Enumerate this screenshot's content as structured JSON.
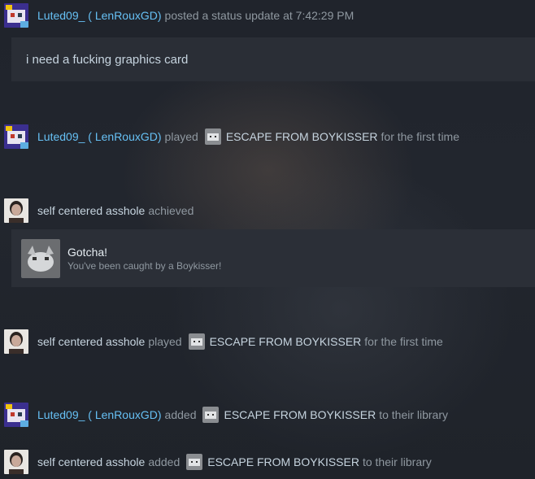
{
  "colors": {
    "link": "#66c0f4",
    "text": "#c6d4df",
    "muted": "#8f98a0",
    "panel": "#2a2e36"
  },
  "icons": {
    "user_avatar_luted": "pixel-avatar-icon",
    "user_avatar_self": "portrait-avatar-icon",
    "game": "game-icon",
    "achievement": "achievement-icon"
  },
  "feed": [
    {
      "user": "Luted09_ ( LenRouxGD)",
      "action": "posted a status update at 7:42:29 PM",
      "status": "i need a fucking graphics card"
    },
    {
      "user": "Luted09_ ( LenRouxGD)",
      "verb": "played",
      "game": "ESCAPE FROM BOYKISSER",
      "tail": "for the first time"
    },
    {
      "user": "self centered asshole",
      "verb": "achieved",
      "achievement": {
        "title": "Gotcha!",
        "description": "You've been caught by a Boykisser!"
      }
    },
    {
      "user": "self centered asshole",
      "verb": "played",
      "game": "ESCAPE FROM BOYKISSER",
      "tail": "for the first time"
    },
    {
      "user": "Luted09_ ( LenRouxGD)",
      "verb": "added",
      "game": "ESCAPE FROM BOYKISSER",
      "tail": "to their library"
    },
    {
      "user": "self centered asshole",
      "verb": "added",
      "game": "ESCAPE FROM BOYKISSER",
      "tail": "to their library"
    }
  ]
}
